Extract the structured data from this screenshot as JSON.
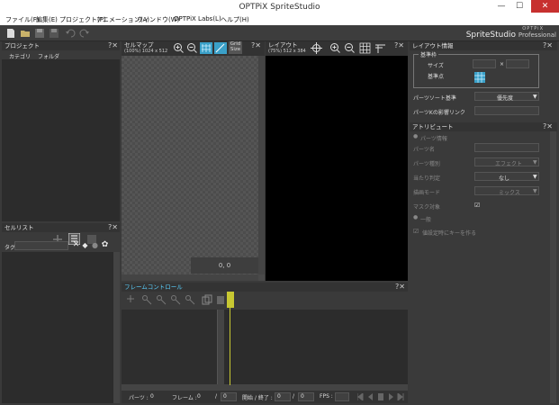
{
  "window": {
    "title": "OPTPiX SpriteStudio",
    "minimize": "—",
    "maximize": "☐",
    "close": "✕"
  },
  "menu": {
    "items": [
      "ファイル(F)",
      "編集(E)",
      "プロジェクト(P)",
      "アニメーション(A)",
      "ウィンドウ(W)",
      "OPTPiX Labs(L)",
      "ヘルプ(H)"
    ]
  },
  "logo": {
    "brand_small": "OPTPiX",
    "brand_main": "SpriteStudio",
    "edition": "Professional"
  },
  "panels": {
    "project": {
      "title": "プロジェクト",
      "tabs": [
        "カテゴリ",
        "フォルダ"
      ]
    },
    "cellmap": {
      "title": "セルマップ",
      "info": "(100%) 1024 x 512",
      "grid_label": "Grid",
      "size_label": "Size",
      "coord": "0, 0"
    },
    "layout": {
      "title": "レイアウト",
      "info": "(75%) 512 x 384"
    },
    "celllist": {
      "title": "セルリスト",
      "tag_label": "タグ"
    },
    "frame_control": {
      "title": "フレームコントロール",
      "parts_label": "パーツ :",
      "parts_value": "0",
      "frame_label": "フレーム :",
      "frame_value": "0",
      "frame_total": "0",
      "range_label": "開始 / 終了 :",
      "range_start": "0",
      "range_end": "0",
      "fps_label": "FPS :"
    },
    "layout_info": {
      "title": "レイアウト情報",
      "group_title": "基準枠",
      "size_label": "サイズ",
      "times": "×",
      "anchor_label": "基準点",
      "sort_label": "パーツソート基準",
      "sort_value": "優先度",
      "bg_label": "パーツKの影響リンク"
    },
    "attribute": {
      "title": "アトリビュート",
      "section_parts": "パーツ情報",
      "name_label": "パーツ名",
      "type_label": "パーツ種別",
      "type_value": "エフェクト",
      "hit_label": "当たり判定",
      "hit_value": "なし",
      "draw_label": "描画モード",
      "draw_value": "ミックス",
      "mask_label": "マスク対象",
      "section_general": "一般",
      "key_label": "値設定時にキーを作る"
    }
  },
  "colors": {
    "accent": "#5bd1ff",
    "panel_bg": "#3a3a3a",
    "canvas_bg": "#000000",
    "playhead": "#c8c832"
  },
  "icons": [
    "new-file-icon",
    "open-folder-icon",
    "save-icon",
    "save-all-icon",
    "undo-icon",
    "redo-icon",
    "zoom-in-icon",
    "zoom-out-icon",
    "grid-icon",
    "crosshair-icon",
    "close-icon",
    "gear-icon",
    "tag-icon"
  ]
}
